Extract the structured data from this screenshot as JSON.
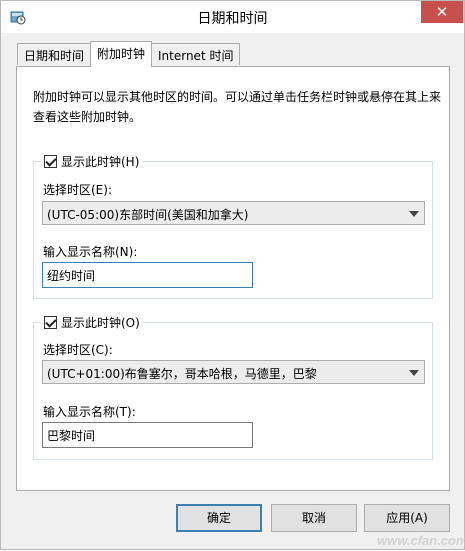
{
  "window": {
    "title": "日期和时间",
    "close_glyph": "✕"
  },
  "tabs": [
    {
      "label": "日期和时间",
      "active": false
    },
    {
      "label": "附加时钟",
      "active": true
    },
    {
      "label": "Internet 时间",
      "active": false
    }
  ],
  "description": "附加时钟可以显示其他时区的时间。可以通过单击任务栏时钟或悬停在其上来查看这些附加时钟。",
  "clock1": {
    "checkbox_label": "显示此时钟(H)",
    "checked": true,
    "timezone_label": "选择时区(E):",
    "timezone_value": "(UTC-05:00)东部时间(美国和加拿大)",
    "name_label": "输入显示名称(N):",
    "name_value": "纽约时间"
  },
  "clock2": {
    "checkbox_label": "显示此时钟(O)",
    "checked": true,
    "timezone_label": "选择时区(C):",
    "timezone_value": "(UTC+01:00)布鲁塞尔，哥本哈根，马德里，巴黎",
    "name_label": "输入显示名称(T):",
    "name_value": "巴黎时间"
  },
  "buttons": {
    "ok": "确定",
    "cancel": "取消",
    "apply": "应用(A)"
  },
  "watermark": "www.cfan.com.cn",
  "icons": {
    "app": "clock-globe-icon",
    "close": "close-icon",
    "dropdown": "chevron-down-icon",
    "check": "check-icon"
  }
}
